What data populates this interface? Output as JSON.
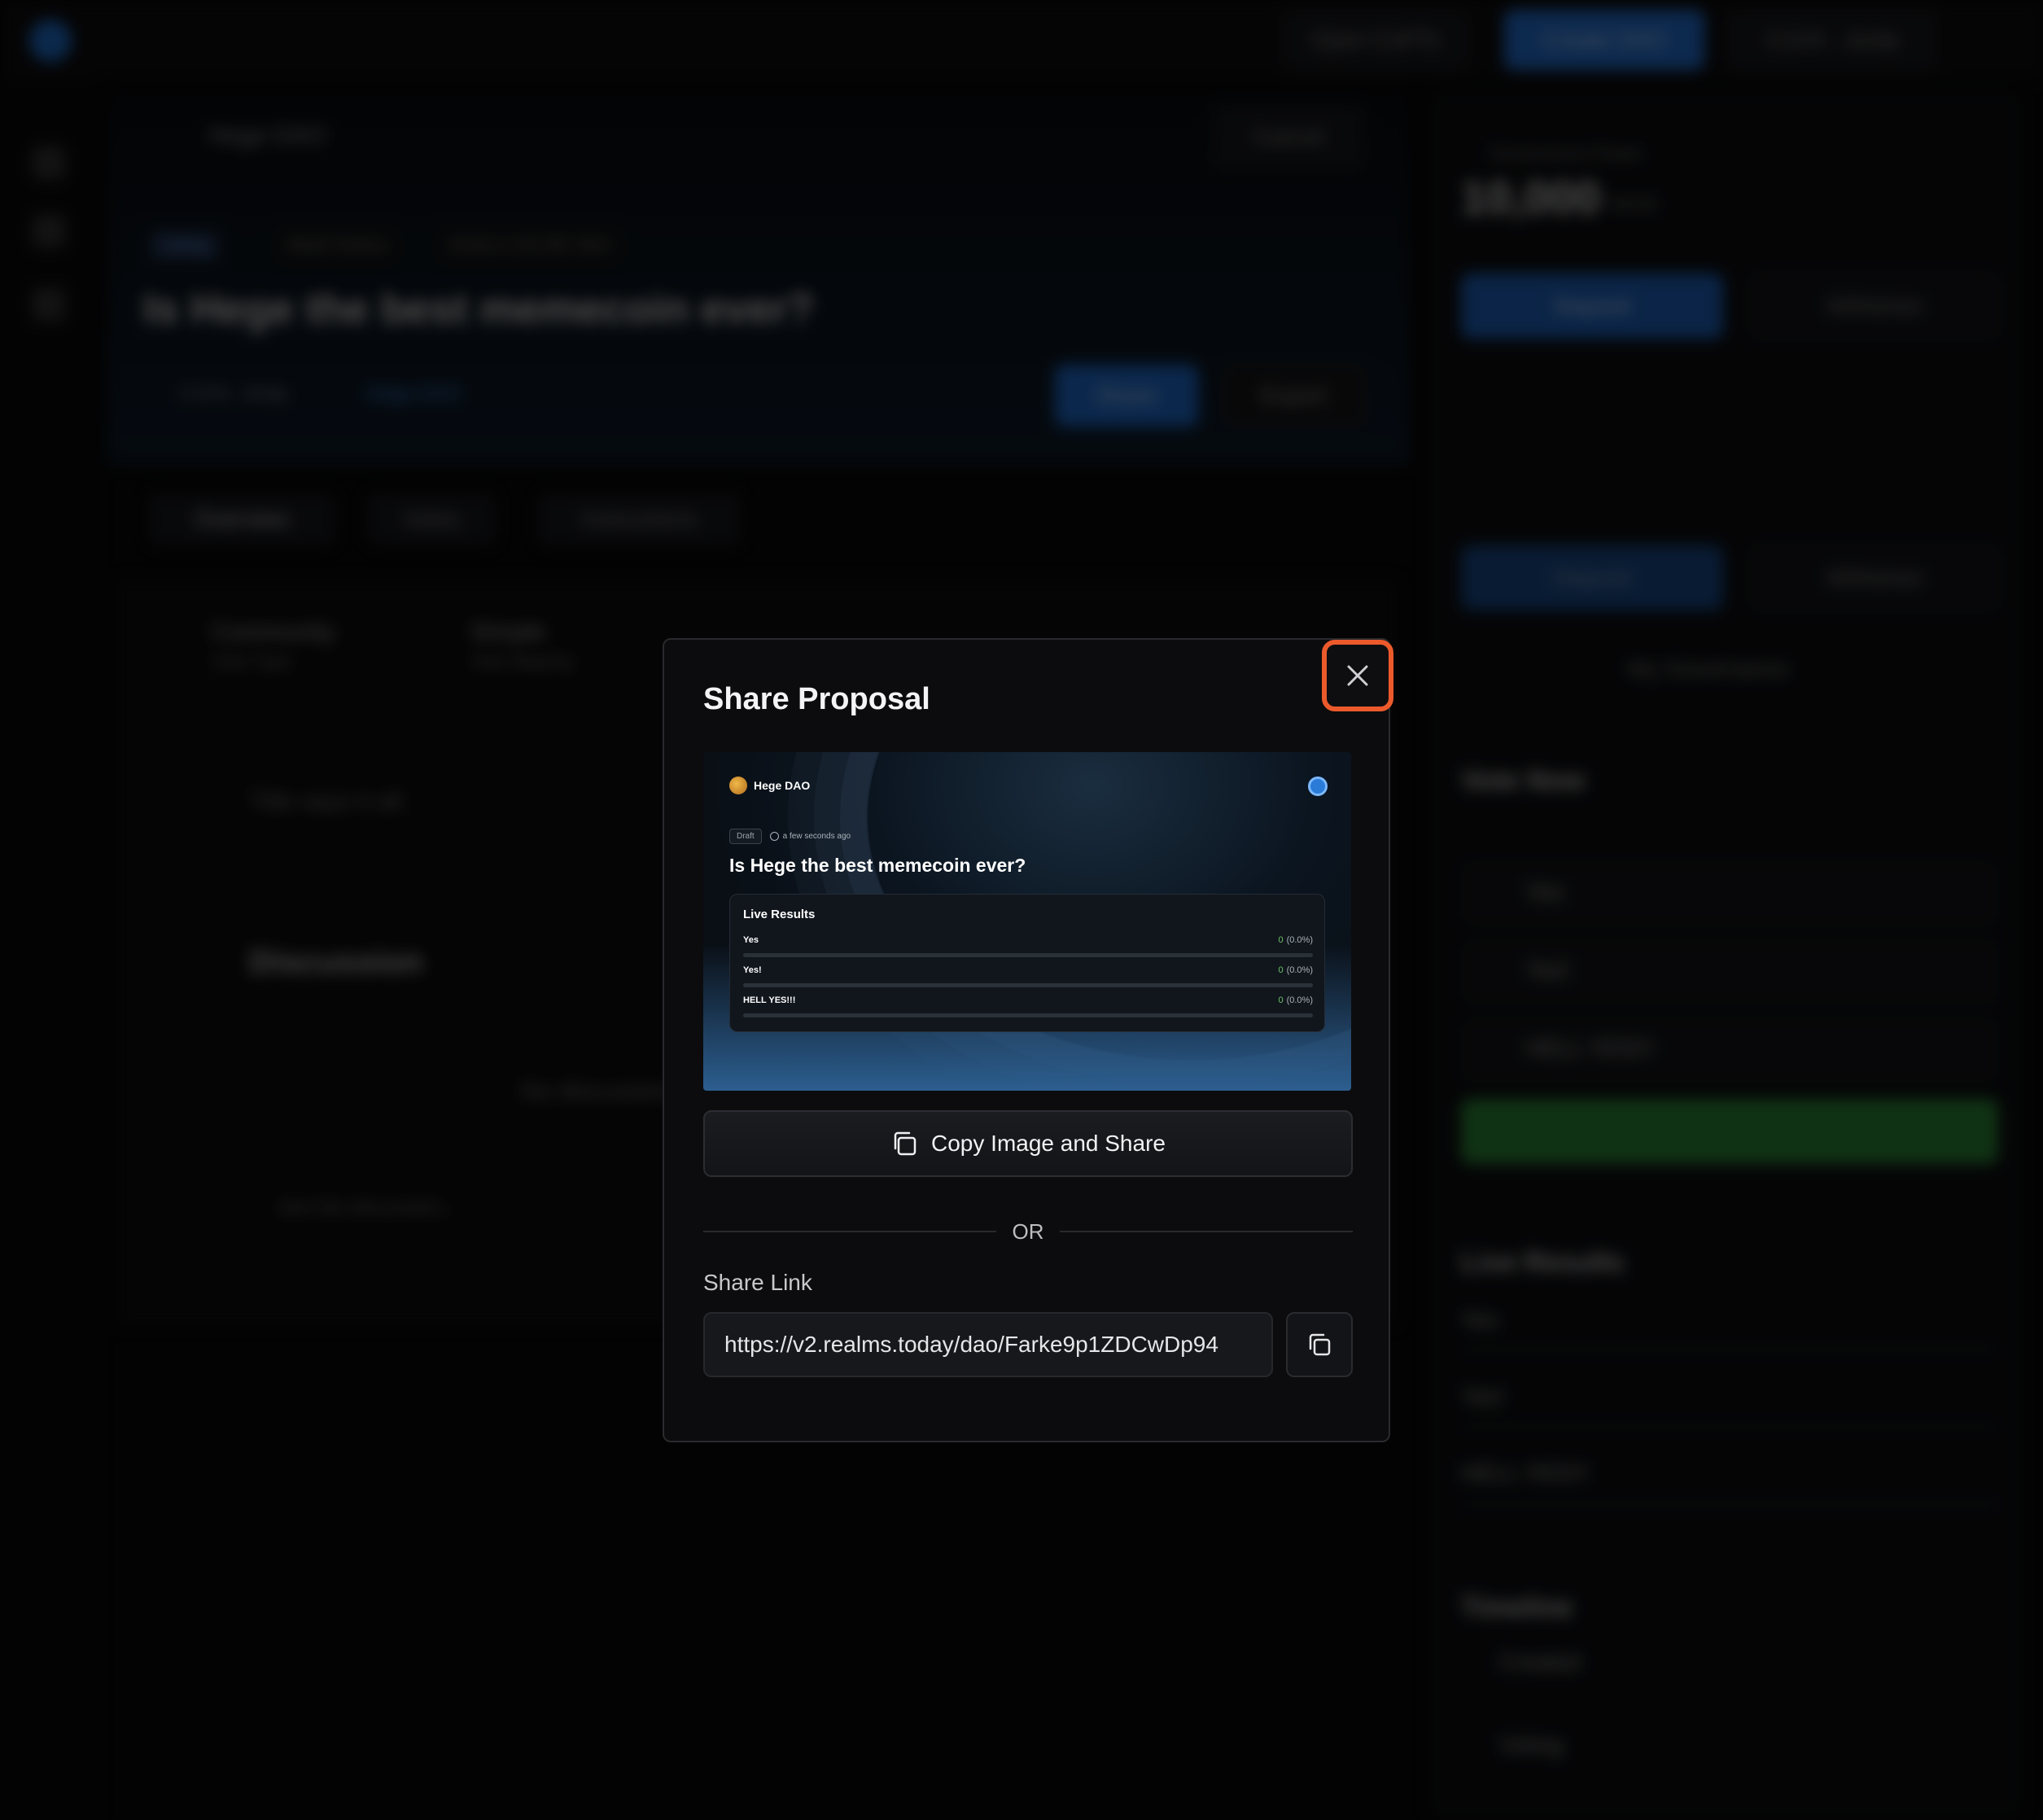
{
  "background": {
    "topbar": {
      "chain_label": "Open CoPTs",
      "create_label": "Create DAO",
      "wallet_label": "C1H4 ...bs4p"
    },
    "header": {
      "dao_name": "Hege DAO",
      "cancel_label": "Cancel",
      "status_chip": "Voting",
      "chip_2": "Multi Choice",
      "chip_3": "Ends in 2d 20h 16m",
      "title": "Is Hege the best memecoin ever?",
      "author": "C1H4...bs4p",
      "author_dao": "Hege DAO",
      "share_label": "Share",
      "export_label": "Export"
    },
    "tabs": [
      "Overview",
      "Votes",
      "Instructions"
    ],
    "content": {
      "info_1_title": "Community",
      "info_1_sub": "Vote Type",
      "info_2_title": "Simple",
      "info_2_sub": "Vote Majority",
      "body_text": "Title says it all.",
      "discussion_title": "Discussion",
      "discussion_empty": "No discussion",
      "discussion_placeholder": "Join the discussion..."
    },
    "right": {
      "governance_label": "Governance Power",
      "amount": "10,000",
      "amount_unit": "HEGE",
      "deposit_label": "Deposit",
      "withdraw_label": "Withdraw",
      "my_governance": "My Governance",
      "vote_now": "Vote Now",
      "options": [
        "Yes",
        "Yes!",
        "HELL YES!!!"
      ],
      "vote_label": "Vote",
      "live_results": "Live Results",
      "timeline": "Timeline",
      "timeline_items": [
        "Created",
        "Voting"
      ]
    }
  },
  "modal": {
    "title": "Share Proposal",
    "preview": {
      "dao_name": "Hege DAO",
      "status": "Draft",
      "time": "a few seconds ago",
      "proposal_title": "Is Hege the best memecoin ever?",
      "results_title": "Live Results",
      "results": [
        {
          "label": "Yes",
          "count": "0",
          "pct": "(0.0%)",
          "fraction": 0
        },
        {
          "label": "Yes!",
          "count": "0",
          "pct": "(0.0%)",
          "fraction": 0
        },
        {
          "label": "HELL YES!!!",
          "count": "0",
          "pct": "(0.0%)",
          "fraction": 0
        }
      ]
    },
    "copy_image_label": "Copy Image and Share",
    "or_label": "OR",
    "share_link_label": "Share Link",
    "share_link_value": "https://v2.realms.today/dao/Farke9p1ZDCwDp94"
  },
  "colors": {
    "accent": "#ec5a2c",
    "primary_blue": "#1f6fd6",
    "result_green": "#6fc36a"
  }
}
